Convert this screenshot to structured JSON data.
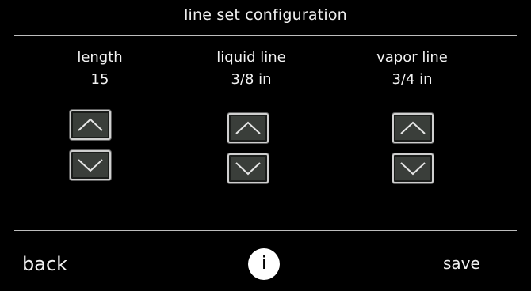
{
  "header": {
    "title": "line set configuration"
  },
  "settings": [
    {
      "label": "length",
      "value": "15"
    },
    {
      "label": "liquid line",
      "value": "3/8 in"
    },
    {
      "label": "vapor line",
      "value": "3/4 in"
    }
  ],
  "footer": {
    "back_label": "back",
    "info_label": "i",
    "save_label": "save"
  },
  "icons": {
    "increase": "chevron-up-icon",
    "decrease": "chevron-down-icon",
    "info": "info-icon"
  },
  "colors": {
    "background": "#000000",
    "text": "#ececec",
    "button_fill": "#3a3e3a",
    "button_border": "#cfcfcf",
    "divider": "#bdbdbd"
  }
}
